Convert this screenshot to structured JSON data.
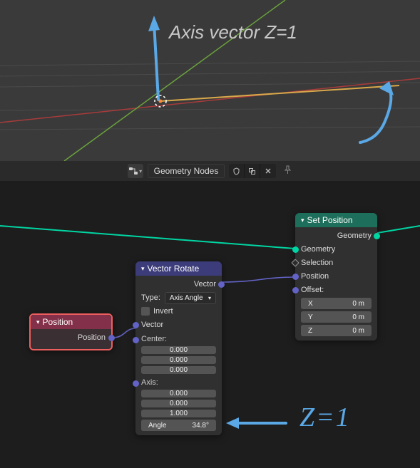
{
  "viewport_annotation": "Axis vector Z=1",
  "header": {
    "dropdown_label": "Geometry Nodes"
  },
  "nodes": {
    "position": {
      "title": "Position",
      "out_position": "Position"
    },
    "vecrot": {
      "title": "Vector Rotate",
      "out_vector": "Vector",
      "type_label": "Type:",
      "type_value": "Axis Angle",
      "invert": "Invert",
      "in_vector": "Vector",
      "center_label": "Center:",
      "center_x": "0.000",
      "center_y": "0.000",
      "center_z": "0.000",
      "axis_label": "Axis:",
      "axis_x": "0.000",
      "axis_y": "0.000",
      "axis_z": "1.000",
      "angle_label": "Angle",
      "angle_value": "34.8°"
    },
    "setpos": {
      "title": "Set Position",
      "out_geometry": "Geometry",
      "in_geometry": "Geometry",
      "in_selection": "Selection",
      "in_position": "Position",
      "offset_label": "Offset:",
      "offset_x_k": "X",
      "offset_x_v": "0 m",
      "offset_y_k": "Y",
      "offset_y_v": "0 m",
      "offset_z_k": "Z",
      "offset_z_v": "0 m"
    }
  },
  "editor_annotation": "Z=1"
}
